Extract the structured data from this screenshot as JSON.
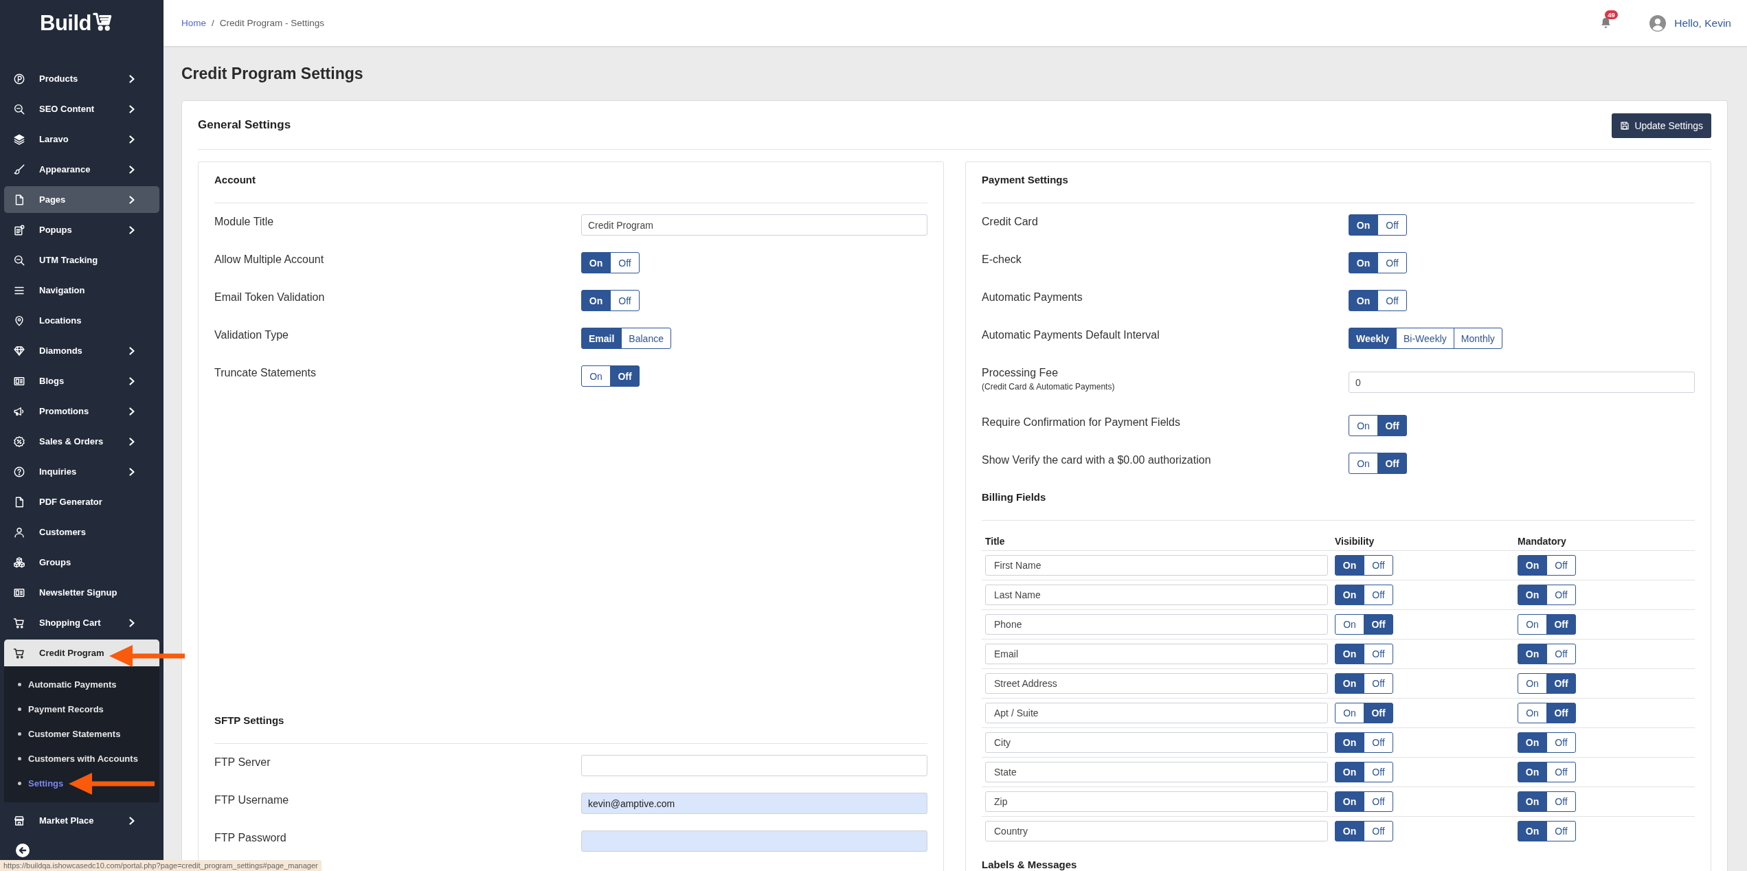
{
  "sidebar": {
    "logo": "Build",
    "items": [
      {
        "label": "Products",
        "expandable": true,
        "expanded": false,
        "hovered": false
      },
      {
        "label": "SEO Content",
        "expandable": true,
        "expanded": false,
        "hovered": false
      },
      {
        "label": "Laravo",
        "expandable": true,
        "expanded": false,
        "hovered": false
      },
      {
        "label": "Appearance",
        "expandable": true,
        "expanded": false,
        "hovered": false
      },
      {
        "label": "Pages",
        "expandable": true,
        "expanded": false,
        "hovered": true
      },
      {
        "label": "Popups",
        "expandable": true,
        "expanded": false,
        "hovered": false
      },
      {
        "label": "UTM Tracking",
        "expandable": false,
        "expanded": false,
        "hovered": false
      },
      {
        "label": "Navigation",
        "expandable": false,
        "expanded": false,
        "hovered": false
      },
      {
        "label": "Locations",
        "expandable": false,
        "expanded": false,
        "hovered": false
      },
      {
        "label": "Diamonds",
        "expandable": true,
        "expanded": false,
        "hovered": false
      },
      {
        "label": "Blogs",
        "expandable": true,
        "expanded": false,
        "hovered": false
      },
      {
        "label": "Promotions",
        "expandable": true,
        "expanded": false,
        "hovered": false
      },
      {
        "label": "Sales & Orders",
        "expandable": true,
        "expanded": false,
        "hovered": false
      },
      {
        "label": "Inquiries",
        "expandable": true,
        "expanded": false,
        "hovered": false
      },
      {
        "label": "PDF Generator",
        "expandable": false,
        "expanded": false,
        "hovered": false
      },
      {
        "label": "Customers",
        "expandable": false,
        "expanded": false,
        "hovered": false
      },
      {
        "label": "Groups",
        "expandable": false,
        "expanded": false,
        "hovered": false
      },
      {
        "label": "Newsletter Signup",
        "expandable": false,
        "expanded": false,
        "hovered": false
      },
      {
        "label": "Shopping Cart",
        "expandable": true,
        "expanded": false,
        "hovered": false
      },
      {
        "label": "Credit Program",
        "expanded": true,
        "hovered": false,
        "children": [
          {
            "label": "Automatic Payments",
            "selected": false
          },
          {
            "label": "Payment Records",
            "selected": false
          },
          {
            "label": "Customer Statements",
            "selected": false
          },
          {
            "label": "Customers with Accounts",
            "selected": false
          },
          {
            "label": "Settings",
            "selected": true
          }
        ]
      },
      {
        "label": "Market Place",
        "expandable": true,
        "expanded": false,
        "hovered": false
      }
    ]
  },
  "header": {
    "breadcrumb": [
      {
        "kind": "link",
        "label": "Home"
      },
      {
        "kind": "separator",
        "label": "/"
      },
      {
        "kind": "current",
        "label": "Credit Program - Settings"
      }
    ],
    "notification_count": "49",
    "greeting": "Hello, Kevin"
  },
  "page_title": "Credit Program Settings",
  "general_settings": {
    "title": "General Settings",
    "update_button": "Update Settings",
    "account": {
      "title": "Account",
      "rows": [
        {
          "kind": "text",
          "label": "Module Title",
          "value": "Credit Program",
          "autofilled": false
        },
        {
          "kind": "toggle",
          "label": "Allow Multiple Account",
          "options": [
            {
              "label": "On",
              "selected": true
            },
            {
              "label": "Off",
              "selected": false
            }
          ]
        },
        {
          "kind": "toggle",
          "label": "Email Token Validation",
          "options": [
            {
              "label": "On",
              "selected": true
            },
            {
              "label": "Off",
              "selected": false
            }
          ]
        },
        {
          "kind": "toggle",
          "label": "Validation Type",
          "options": [
            {
              "label": "Email",
              "selected": true
            },
            {
              "label": "Balance",
              "selected": false
            }
          ]
        },
        {
          "kind": "toggle",
          "label": "Truncate Statements",
          "options": [
            {
              "label": "On",
              "selected": false
            },
            {
              "label": "Off",
              "selected": true
            }
          ]
        }
      ]
    },
    "sftp": {
      "title": "SFTP Settings",
      "rows": [
        {
          "kind": "text",
          "label": "FTP Server",
          "autofilled": false
        },
        {
          "kind": "text",
          "label": "FTP Username",
          "value": "kevin@amptive.com",
          "autofilled": true
        },
        {
          "kind": "text",
          "label": "FTP Password",
          "autofilled": true
        }
      ]
    },
    "payment": {
      "title": "Payment Settings",
      "rows": [
        {
          "kind": "toggle",
          "label": "Credit Card",
          "options": [
            {
              "label": "On",
              "selected": true
            },
            {
              "label": "Off",
              "selected": false
            }
          ]
        },
        {
          "kind": "toggle",
          "label": "E-check",
          "options": [
            {
              "label": "On",
              "selected": true
            },
            {
              "label": "Off",
              "selected": false
            }
          ]
        },
        {
          "kind": "toggle",
          "label": "Automatic Payments",
          "options": [
            {
              "label": "On",
              "selected": true
            },
            {
              "label": "Off",
              "selected": false
            }
          ]
        },
        {
          "kind": "toggle",
          "label": "Automatic Payments Default Interval",
          "options": [
            {
              "label": "Weekly",
              "selected": true
            },
            {
              "label": "Bi-Weekly",
              "selected": false
            },
            {
              "label": "Monthly",
              "selected": false
            }
          ]
        },
        {
          "kind": "text",
          "label": "Processing Fee",
          "note": "(Credit Card & Automatic Payments)",
          "value": "0",
          "autofilled": false
        },
        {
          "kind": "toggle",
          "label": "Require Confirmation for Payment Fields",
          "options": [
            {
              "label": "On",
              "selected": false
            },
            {
              "label": "Off",
              "selected": true
            }
          ]
        },
        {
          "kind": "toggle",
          "label": "Show Verify the card with a $0.00 authorization",
          "options": [
            {
              "label": "On",
              "selected": false
            },
            {
              "label": "Off",
              "selected": true
            }
          ]
        }
      ]
    },
    "billing_fields": {
      "title": "Billing Fields",
      "columns": [
        "Title",
        "Visibility",
        "Mandatory"
      ],
      "rows": [
        {
          "title": "First Name",
          "visibility": [
            {
              "label": "On",
              "selected": true
            },
            {
              "label": "Off",
              "selected": false
            }
          ],
          "mandatory": [
            {
              "label": "On",
              "selected": true
            },
            {
              "label": "Off",
              "selected": false
            }
          ]
        },
        {
          "title": "Last Name",
          "visibility": [
            {
              "label": "On",
              "selected": true
            },
            {
              "label": "Off",
              "selected": false
            }
          ],
          "mandatory": [
            {
              "label": "On",
              "selected": true
            },
            {
              "label": "Off",
              "selected": false
            }
          ]
        },
        {
          "title": "Phone",
          "visibility": [
            {
              "label": "On",
              "selected": false
            },
            {
              "label": "Off",
              "selected": true
            }
          ],
          "mandatory": [
            {
              "label": "On",
              "selected": false
            },
            {
              "label": "Off",
              "selected": true
            }
          ]
        },
        {
          "title": "Email",
          "visibility": [
            {
              "label": "On",
              "selected": true
            },
            {
              "label": "Off",
              "selected": false
            }
          ],
          "mandatory": [
            {
              "label": "On",
              "selected": true
            },
            {
              "label": "Off",
              "selected": false
            }
          ]
        },
        {
          "title": "Street Address",
          "visibility": [
            {
              "label": "On",
              "selected": true
            },
            {
              "label": "Off",
              "selected": false
            }
          ],
          "mandatory": [
            {
              "label": "On",
              "selected": false
            },
            {
              "label": "Off",
              "selected": true
            }
          ]
        },
        {
          "title": "Apt / Suite",
          "visibility": [
            {
              "label": "On",
              "selected": false
            },
            {
              "label": "Off",
              "selected": true
            }
          ],
          "mandatory": [
            {
              "label": "On",
              "selected": false
            },
            {
              "label": "Off",
              "selected": true
            }
          ]
        },
        {
          "title": "City",
          "visibility": [
            {
              "label": "On",
              "selected": true
            },
            {
              "label": "Off",
              "selected": false
            }
          ],
          "mandatory": [
            {
              "label": "On",
              "selected": true
            },
            {
              "label": "Off",
              "selected": false
            }
          ]
        },
        {
          "title": "State",
          "visibility": [
            {
              "label": "On",
              "selected": true
            },
            {
              "label": "Off",
              "selected": false
            }
          ],
          "mandatory": [
            {
              "label": "On",
              "selected": true
            },
            {
              "label": "Off",
              "selected": false
            }
          ]
        },
        {
          "title": "Zip",
          "visibility": [
            {
              "label": "On",
              "selected": true
            },
            {
              "label": "Off",
              "selected": false
            }
          ],
          "mandatory": [
            {
              "label": "On",
              "selected": true
            },
            {
              "label": "Off",
              "selected": false
            }
          ]
        },
        {
          "title": "Country",
          "visibility": [
            {
              "label": "On",
              "selected": true
            },
            {
              "label": "Off",
              "selected": false
            }
          ],
          "mandatory": [
            {
              "label": "On",
              "selected": true
            },
            {
              "label": "Off",
              "selected": false
            }
          ]
        }
      ]
    },
    "labels_messages": {
      "title": "Labels & Messages"
    }
  },
  "status_bar": {
    "url": "https://buildqa.ishowcasedc10.com/portal.php?page=credit_program_settings#page_manager"
  }
}
